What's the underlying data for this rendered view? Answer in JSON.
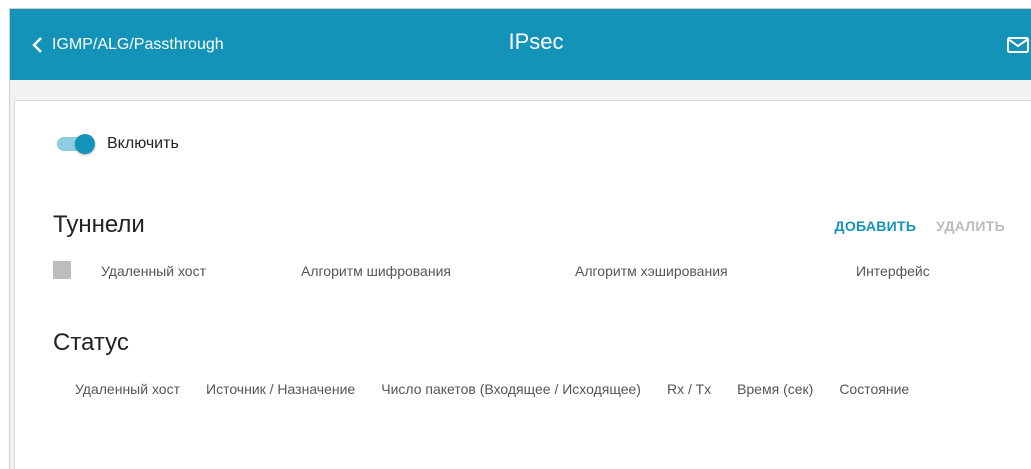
{
  "header": {
    "back_label": "IGMP/ALG/Passthrough",
    "title": "IPsec"
  },
  "toggle": {
    "label": "Включить",
    "enabled": true
  },
  "tunnels": {
    "title": "Туннели",
    "add_label": "ДОБАВИТЬ",
    "delete_label": "УДАЛИТЬ",
    "columns": [
      "Удаленный хост",
      "Алгоритм шифрования",
      "Алгоритм хэширования",
      "Интерфейс"
    ]
  },
  "status": {
    "title": "Статус",
    "columns": [
      "Удаленный хост",
      "Источник / Назначение",
      "Число пакетов (Входящее / Исходящее)",
      "Rx / Tx",
      "Время (сек)",
      "Состояние"
    ]
  },
  "colors": {
    "accent": "#1493b8",
    "disabled": "#bbbbbb"
  }
}
